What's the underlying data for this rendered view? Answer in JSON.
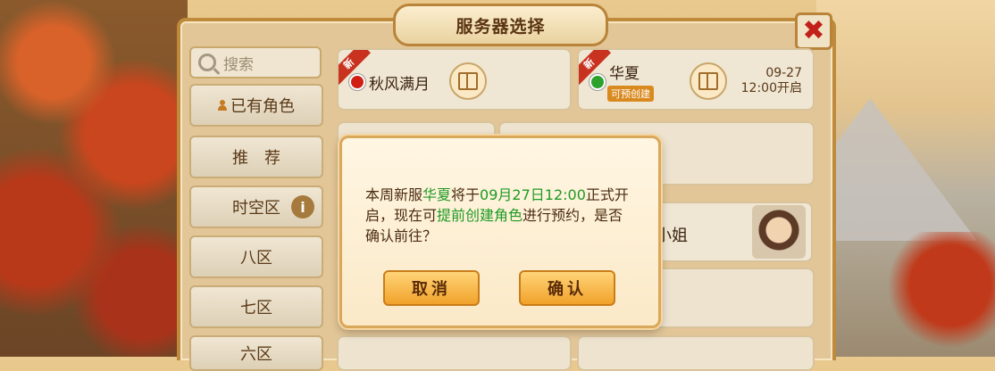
{
  "title": "服务器选择",
  "close_symbol": "✖",
  "search": {
    "placeholder": "搜索"
  },
  "sidebar": {
    "items": [
      {
        "label": "已有角色"
      },
      {
        "label": "推　荐"
      },
      {
        "label": "时空区"
      },
      {
        "label": "八区"
      },
      {
        "label": "七区"
      },
      {
        "label": "六区"
      }
    ],
    "info_symbol": "i"
  },
  "servers": [
    {
      "badge": "新",
      "name": "秋风满月",
      "status_color": "#d01f12"
    },
    {
      "badge": "新",
      "name": "华夏",
      "status_color": "#2ca22c",
      "tag": "可预创建",
      "date": "09-27",
      "time": "12:00开启"
    }
  ],
  "background_card": {
    "name": "小姐"
  },
  "dialog": {
    "p1": "本周新服",
    "server": "华夏",
    "p2": "将于",
    "datetime": "09月27日12:00",
    "p3": "正式开启，现在可",
    "action": "提前创建角色",
    "p4": "进行预约，是否确认前往？",
    "cancel": "取消",
    "confirm": "确认"
  },
  "colors": {
    "highlight": "#1f9a24",
    "accent": "#f1a22a",
    "close": "#c2201a"
  }
}
